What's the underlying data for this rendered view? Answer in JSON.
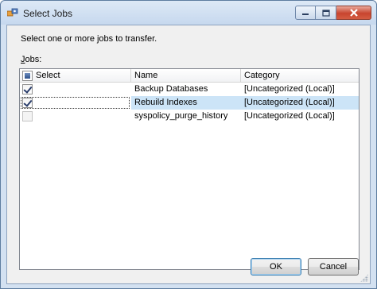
{
  "window": {
    "title": "Select Jobs",
    "icon": "sql-agent-jobs-icon"
  },
  "caption_buttons": [
    "minimize",
    "maximize",
    "close"
  ],
  "dialog": {
    "instruction": "Select one or more jobs to transfer.",
    "jobs_label_prefix": "J",
    "jobs_label_rest": "obs:"
  },
  "grid": {
    "columns": [
      "Select",
      "Name",
      "Category"
    ],
    "header_checkbox_state": "indeterminate",
    "rows": [
      {
        "checked": true,
        "name": "Backup Databases",
        "category": "[Uncategorized (Local)]",
        "selected": false
      },
      {
        "checked": true,
        "name": "Rebuild Indexes",
        "category": "[Uncategorized (Local)]",
        "selected": true
      },
      {
        "checked": false,
        "name": "syspolicy_purge_history",
        "category": "[Uncategorized (Local)]",
        "selected": false,
        "disabled": true
      }
    ]
  },
  "buttons": {
    "ok": "OK",
    "cancel": "Cancel"
  },
  "colors": {
    "title_bar": "#d3e1f1",
    "selection": "#cce4f7",
    "close_button": "#c8452f"
  }
}
